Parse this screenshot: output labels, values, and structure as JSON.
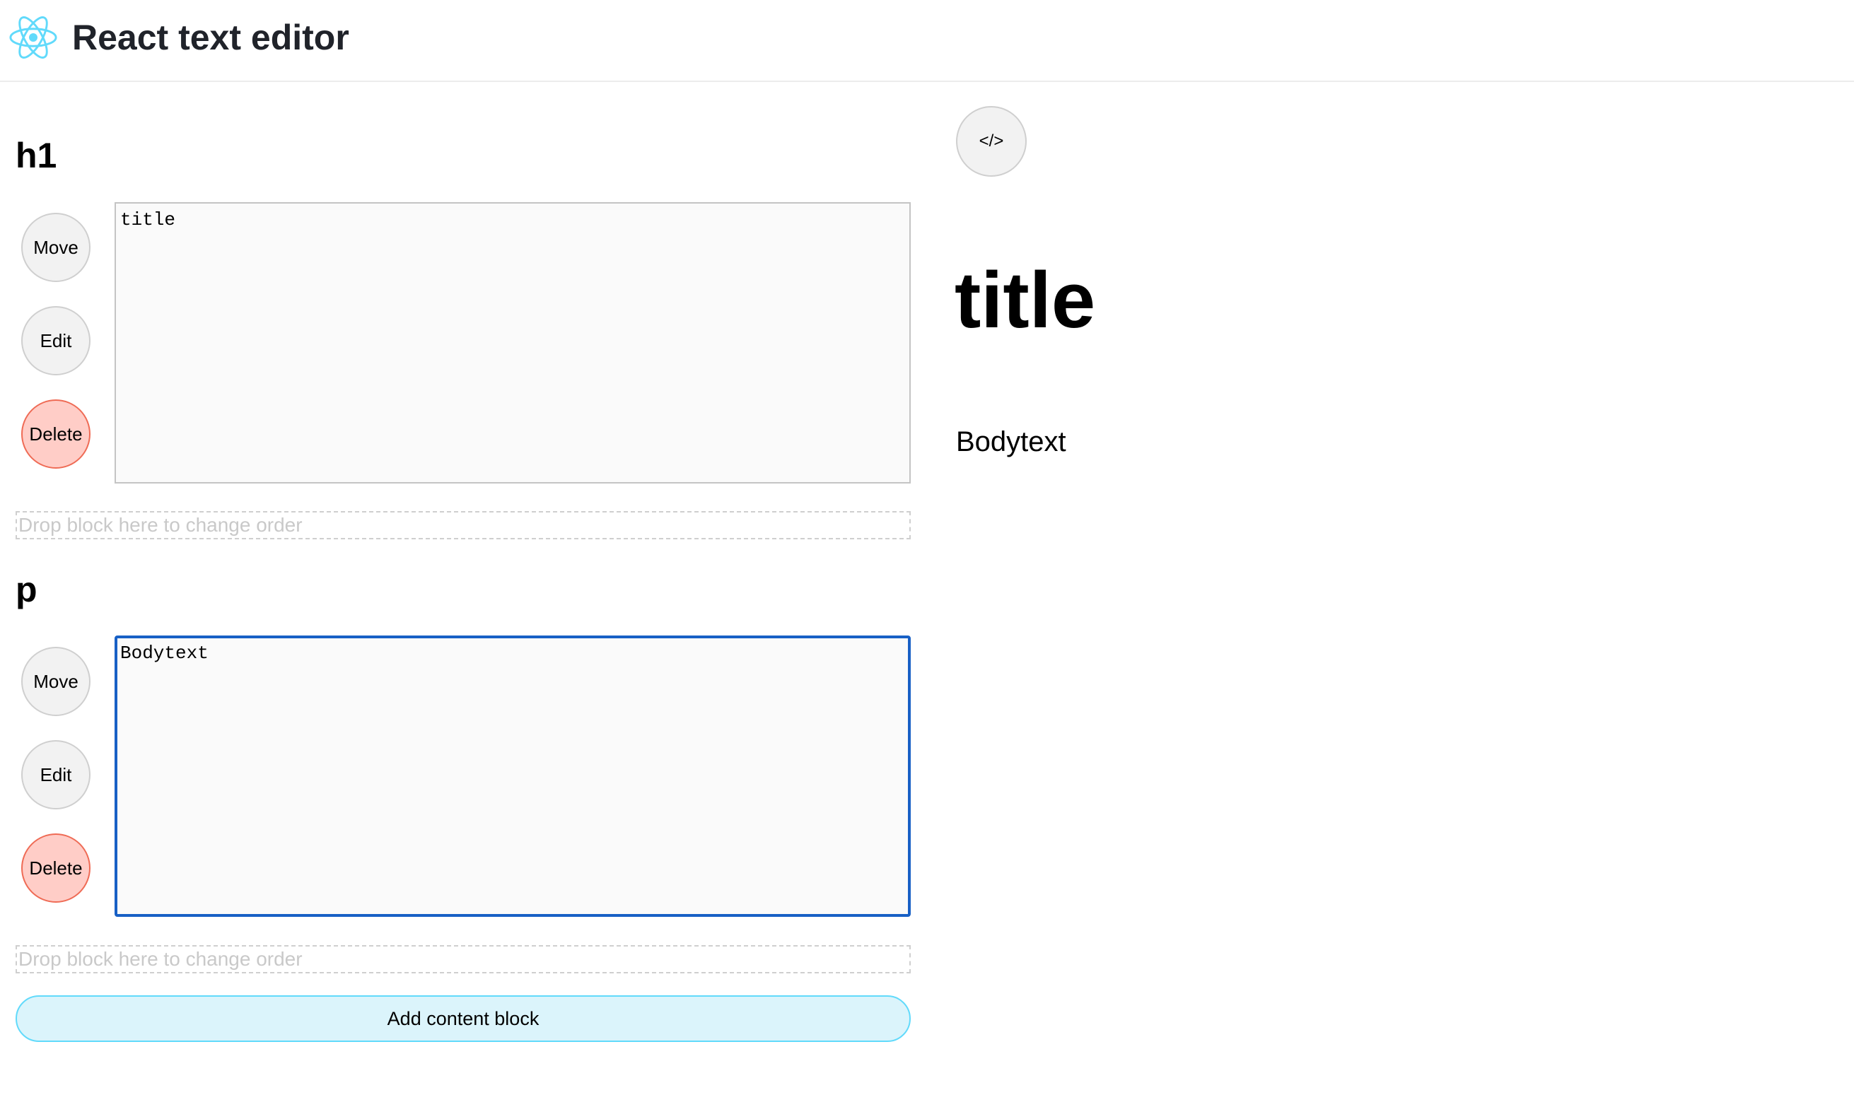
{
  "header": {
    "logo_icon": "react-atom-icon",
    "accent_color": "#61dafb",
    "title": "React text editor"
  },
  "editor": {
    "blocks": [
      {
        "type_label": "h1",
        "move_label": "Move",
        "edit_label": "Edit",
        "delete_label": "Delete",
        "content": "title",
        "focused": false
      },
      {
        "type_label": "p",
        "move_label": "Move",
        "edit_label": "Edit",
        "delete_label": "Delete",
        "content": "Bodytext",
        "focused": true
      }
    ],
    "drop_zone_label": "Drop block here to change order",
    "add_block_label": "Add content block"
  },
  "preview": {
    "code_toggle_label": "</>",
    "heading": "title",
    "paragraph": "Bodytext"
  },
  "colors": {
    "delete_bg": "#ffcdc7",
    "delete_border": "#ef6b55",
    "focus_border": "#1860c5",
    "add_bg": "#dbf4fb"
  }
}
